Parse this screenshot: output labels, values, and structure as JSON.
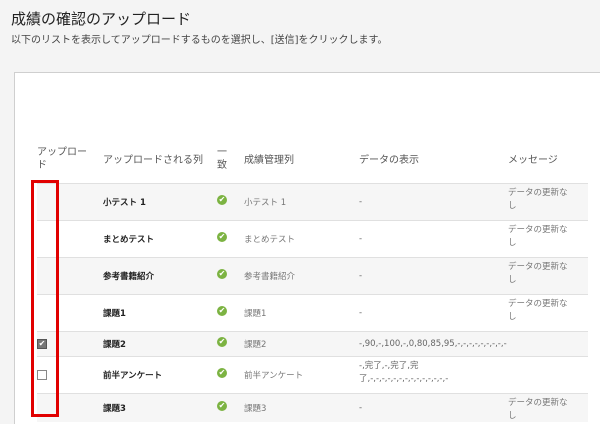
{
  "page": {
    "title": "成績の確認のアップロード",
    "description": "以下のリストを表示してアップロードするものを選択し、[送信]をクリックします。"
  },
  "table": {
    "headers": {
      "upload_line1": "アップロー",
      "upload_line2": "ド",
      "column_uploaded": "アップロードされる列",
      "match_line1": "一",
      "match_line2": "致",
      "grade_column": "成績管理列",
      "data_display": "データの表示",
      "message": "メッセージ"
    },
    "rows": [
      {
        "column": "小テスト 1",
        "grade_column": "小テスト 1",
        "display_line1": "-",
        "display_line2": "",
        "message_line1": "データの更新な",
        "message_line2": "し",
        "checkbox": "none"
      },
      {
        "column": "まとめテスト",
        "grade_column": "まとめテスト",
        "display_line1": "-",
        "display_line2": "",
        "message_line1": "データの更新な",
        "message_line2": "し",
        "checkbox": "none"
      },
      {
        "column": "参考書籍紹介",
        "grade_column": "参考書籍紹介",
        "display_line1": "-",
        "display_line2": "",
        "message_line1": "データの更新な",
        "message_line2": "し",
        "checkbox": "none"
      },
      {
        "column": "課題1",
        "grade_column": "課題1",
        "display_line1": "-",
        "display_line2": "",
        "message_line1": "データの更新な",
        "message_line2": "し",
        "checkbox": "none"
      },
      {
        "column": "課題2",
        "grade_column": "課題2",
        "display_line1": "-,90,-,100,-,0,80,85,95,-,-,-,-,-,-,-,-,-",
        "display_line2": "",
        "message_line1": "",
        "message_line2": "",
        "checkbox": "checked"
      },
      {
        "column": "前半アンケート",
        "grade_column": "前半アンケート",
        "display_line1": "-,完了,-,完了,完",
        "display_line2": "了,-,-,-,-,-,-,-,-,-,-,-,-,-,-",
        "message_line1": "",
        "message_line2": "",
        "checkbox": "unchecked"
      },
      {
        "column": "課題3",
        "grade_column": "課題3",
        "display_line1": "-",
        "display_line2": "",
        "message_line1": "データの更新な",
        "message_line2": "し",
        "checkbox": "none"
      }
    ]
  },
  "icons": {
    "ok": "check-circle-icon",
    "checkmark": "✔"
  },
  "colors": {
    "ok_green": "#7cb342",
    "highlight_red": "#e10000"
  }
}
